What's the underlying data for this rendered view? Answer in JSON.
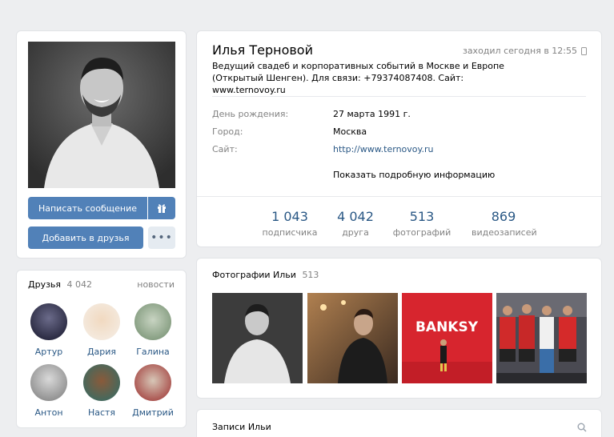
{
  "profile": {
    "name": "Илья Терновой",
    "online_status": "заходил сегодня в 12:55",
    "status_text": "Ведущий свадеб и корпоративных событий в Москве и Европе (Открытый Шенген). Для связи: +79374087408. Сайт: www.ternovoy.ru",
    "info": [
      {
        "label": "День рождения:",
        "value": "27 марта 1991 г."
      },
      {
        "label": "Город:",
        "value": "Москва"
      },
      {
        "label": "Сайт:",
        "value": "http://www.ternovoy.ru"
      }
    ],
    "show_more": "Показать подробную информацию",
    "counters": [
      {
        "num": "1 043",
        "caption": "подписчика"
      },
      {
        "num": "4 042",
        "caption": "друга"
      },
      {
        "num": "513",
        "caption": "фотографий"
      },
      {
        "num": "869",
        "caption": "видеозаписей"
      }
    ]
  },
  "actions": {
    "write_message": "Написать сообщение",
    "add_friend": "Добавить в друзья"
  },
  "friends": {
    "title": "Друзья",
    "count": "4 042",
    "news_link": "новости",
    "list": [
      {
        "name": "Артур"
      },
      {
        "name": "Дария"
      },
      {
        "name": "Галина"
      },
      {
        "name": "Антон"
      },
      {
        "name": "Настя"
      },
      {
        "name": "Дмитрий"
      }
    ]
  },
  "photos": {
    "title": "Фотографии Ильи",
    "count": "513",
    "banner_text": "BANKSY"
  },
  "wall": {
    "title": "Записи Ильи"
  },
  "colors": {
    "accent": "#5181b8",
    "link": "#2a5885",
    "background": "#edeef0"
  }
}
